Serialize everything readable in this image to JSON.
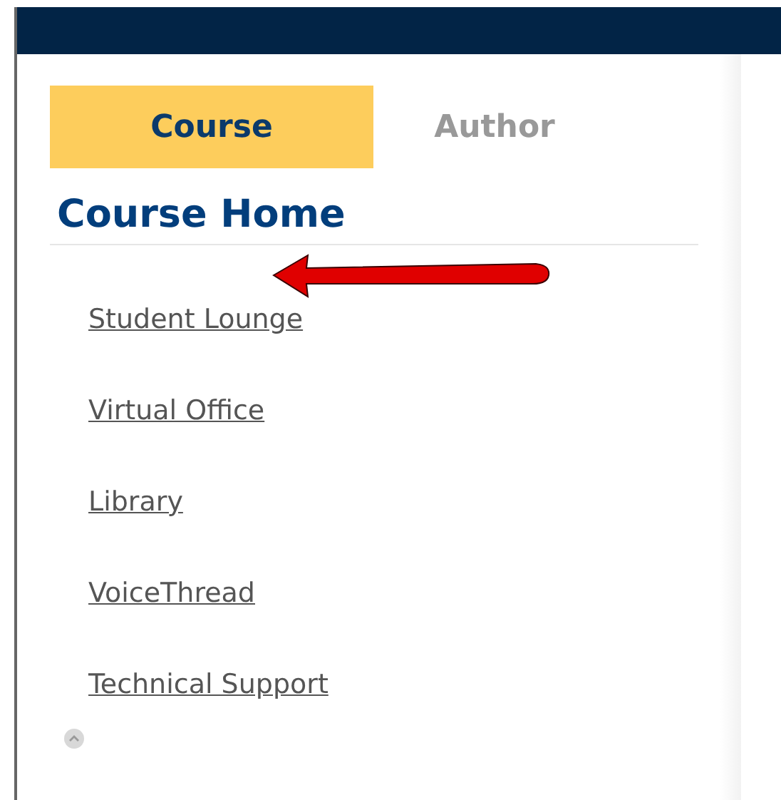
{
  "tabs": [
    {
      "label": "Course",
      "selected": true
    },
    {
      "label": "Author",
      "selected": false
    }
  ],
  "heading": "Course Home",
  "links": [
    {
      "label": "Student Lounge"
    },
    {
      "label": "Virtual Office"
    },
    {
      "label": "Library"
    },
    {
      "label": "VoiceThread"
    },
    {
      "label": "Technical Support"
    }
  ]
}
